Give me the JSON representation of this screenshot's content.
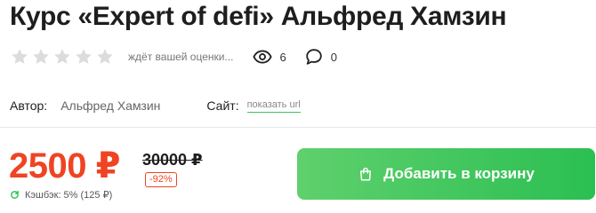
{
  "product": {
    "title": "Курс «Expert of defi» Альфред Хамзин"
  },
  "rating": {
    "stars_total": 5,
    "stars_filled": 0,
    "status_text": "ждёт вашей оценки...",
    "star_color_empty": "#dcdcdc"
  },
  "stats": {
    "views_icon": "eye-icon",
    "views": "6",
    "comments_icon": "comment-icon",
    "comments": "0"
  },
  "meta": {
    "author_label": "Автор:",
    "author_value": "Альфред Хамзин",
    "site_label": "Сайт:",
    "site_link": "показать url"
  },
  "pricing": {
    "price": "2500 ₽",
    "old_price": "30000 ₽",
    "discount": "-92%",
    "cashback_icon": "refresh-icon",
    "cashback": "Кэшбэк: 5% (125 ₽)",
    "price_color": "#ef4423"
  },
  "cart": {
    "icon": "shopping-bag-icon",
    "label": "Добавить в корзину",
    "color_start": "#5fd06d",
    "color_end": "#2bbf52"
  }
}
